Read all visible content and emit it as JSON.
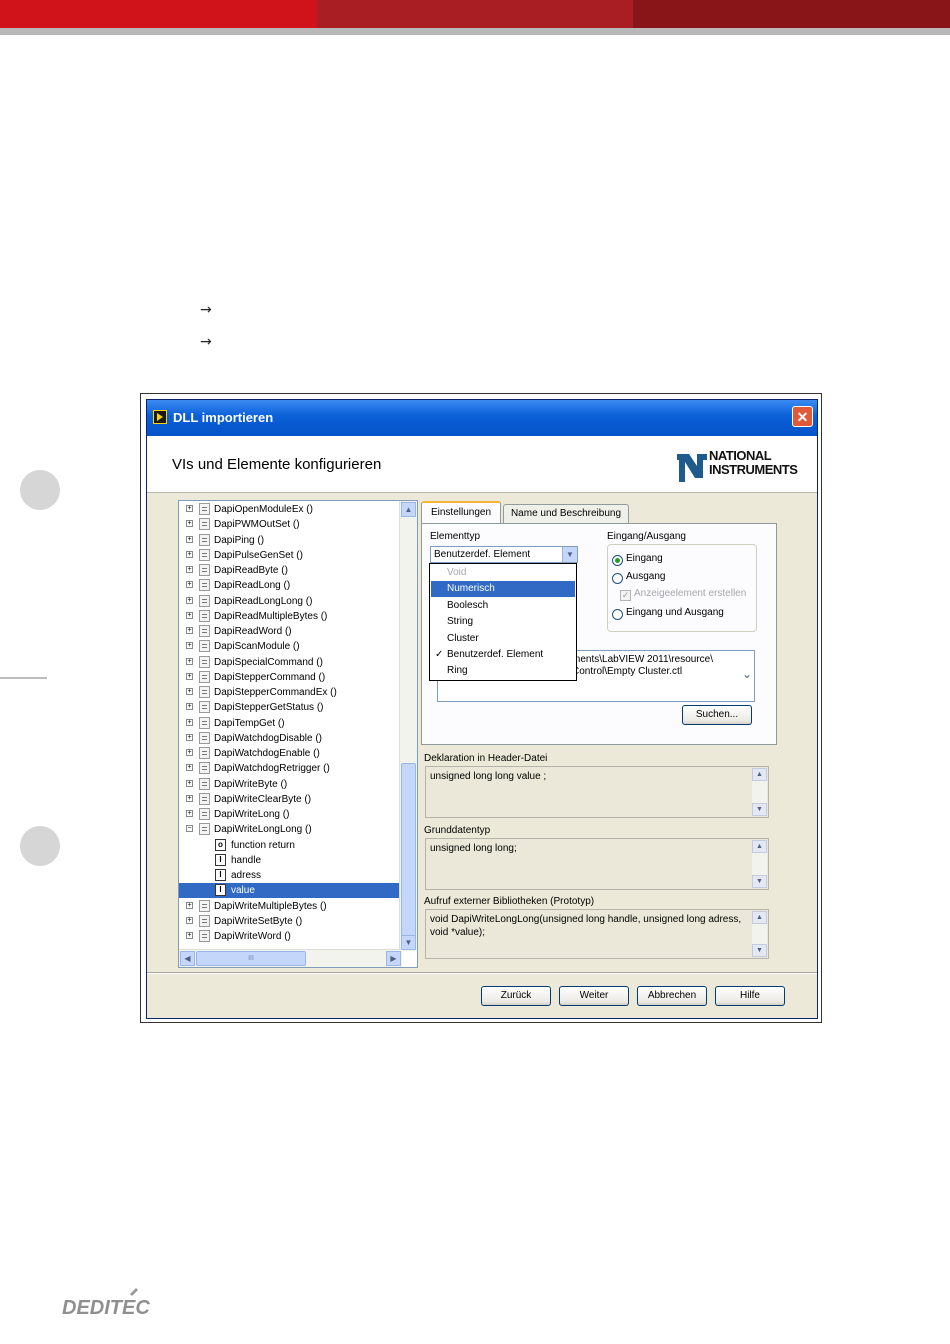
{
  "page": {
    "arrows": [
      "→",
      "→"
    ],
    "brand_logo": "DEDITEC"
  },
  "window": {
    "title": "DLL importieren",
    "close_label": "✕",
    "header_title": "VIs und Elemente konfigurieren",
    "vendor_logo": [
      "NATIONAL",
      "INSTRUMENTS"
    ]
  },
  "tree": {
    "items": [
      "DapiOpenModuleEx ()",
      "DapiPWMOutSet ()",
      "DapiPing ()",
      "DapiPulseGenSet ()",
      "DapiReadByte ()",
      "DapiReadLong ()",
      "DapiReadLongLong ()",
      "DapiReadMultipleBytes ()",
      "DapiReadWord ()",
      "DapiScanModule ()",
      "DapiSpecialCommand ()",
      "DapiStepperCommand ()",
      "DapiStepperCommandEx ()",
      "DapiStepperGetStatus ()",
      "DapiTempGet ()",
      "DapiWatchdogDisable ()",
      "DapiWatchdogEnable ()",
      "DapiWatchdogRetrigger ()",
      "DapiWriteByte ()",
      "DapiWriteClearByte ()",
      "DapiWriteLong ()",
      "DapiWriteLongLong ()"
    ],
    "children": [
      {
        "label": "function return",
        "icon": "o"
      },
      {
        "label": "handle",
        "icon": "I"
      },
      {
        "label": "adress",
        "icon": "I"
      },
      {
        "label": "value",
        "icon": "I"
      }
    ],
    "items_after": [
      "DapiWriteMultipleBytes ()",
      "DapiWriteSetByte ()",
      "DapiWriteWord ()"
    ],
    "hscroll_grip": "III"
  },
  "tabs": {
    "settings": "Einstellungen",
    "name_desc": "Name und Beschreibung"
  },
  "settings": {
    "elementtyp_label": "Elementtyp",
    "elementtyp_value": "Benutzerdef. Element",
    "options": [
      "Void",
      "Numerisch",
      "Boolesch",
      "String",
      "Cluster",
      "Benutzerdef. Element",
      "Ring"
    ],
    "check_mark": "✓",
    "io_label": "Eingang/Ausgang",
    "io_input": "Eingang",
    "io_output": "Ausgang",
    "io_indicator": "Anzeigeelement erstellen",
    "io_both": "Eingang und Ausgang",
    "path_line1": "ments\\LabVIEW 2011\\resource\\",
    "path_line2": "Control\\Empty Cluster.ctl",
    "browse_button": "Suchen..."
  },
  "sections": {
    "header_decl_label": "Deklaration in Header-Datei",
    "header_decl_value": "unsigned long long  value ;",
    "base_type_label": "Grunddatentyp",
    "base_type_value": "unsigned long long;",
    "prototype_label": "Aufruf externer Bibliotheken (Prototyp)",
    "prototype_value": "void  DapiWriteLongLong(unsigned long handle, unsigned long adress, void *value);"
  },
  "buttons": {
    "back": "Zurück",
    "next": "Weiter",
    "cancel": "Abbrechen",
    "help": "Hilfe"
  }
}
